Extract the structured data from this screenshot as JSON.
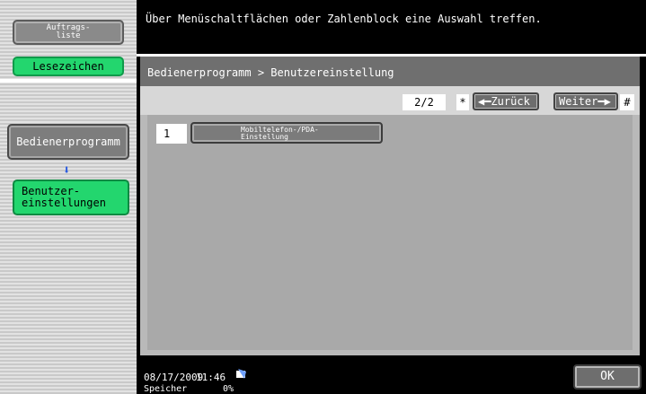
{
  "sidebar": {
    "job_list_label": "Auftrags-\nliste",
    "bookmark_label": "Lesezeichen",
    "utility_label": "Bedienerprogramm",
    "user_settings_label": "Benutzer-\neinstellungen"
  },
  "header": {
    "message": "Über Menüschaltflächen oder Zahlenblock eine Auswahl treffen."
  },
  "main": {
    "breadcrumb": "Bedienerprogramm > Benutzereinstellung",
    "page_indicator": "2/2",
    "star": "*",
    "back_label": "Zurück",
    "next_label": "Weiter",
    "hash": "#",
    "items": [
      {
        "number": "1",
        "label": "Mobiltelefon-/PDA-\nEinstellung"
      }
    ]
  },
  "status": {
    "date": "08/17/2009",
    "time": "11:46",
    "memory_label": "Speicher",
    "memory_value": "0%",
    "ok_label": "OK"
  },
  "icons": {
    "arrow_down": "arrow-down-icon",
    "arrow_left": "arrow-left-icon",
    "arrow_right": "arrow-right-icon",
    "status": "status-icon"
  },
  "colors": {
    "bookmark": "#23d66e",
    "arrow": "#2a5be0"
  }
}
